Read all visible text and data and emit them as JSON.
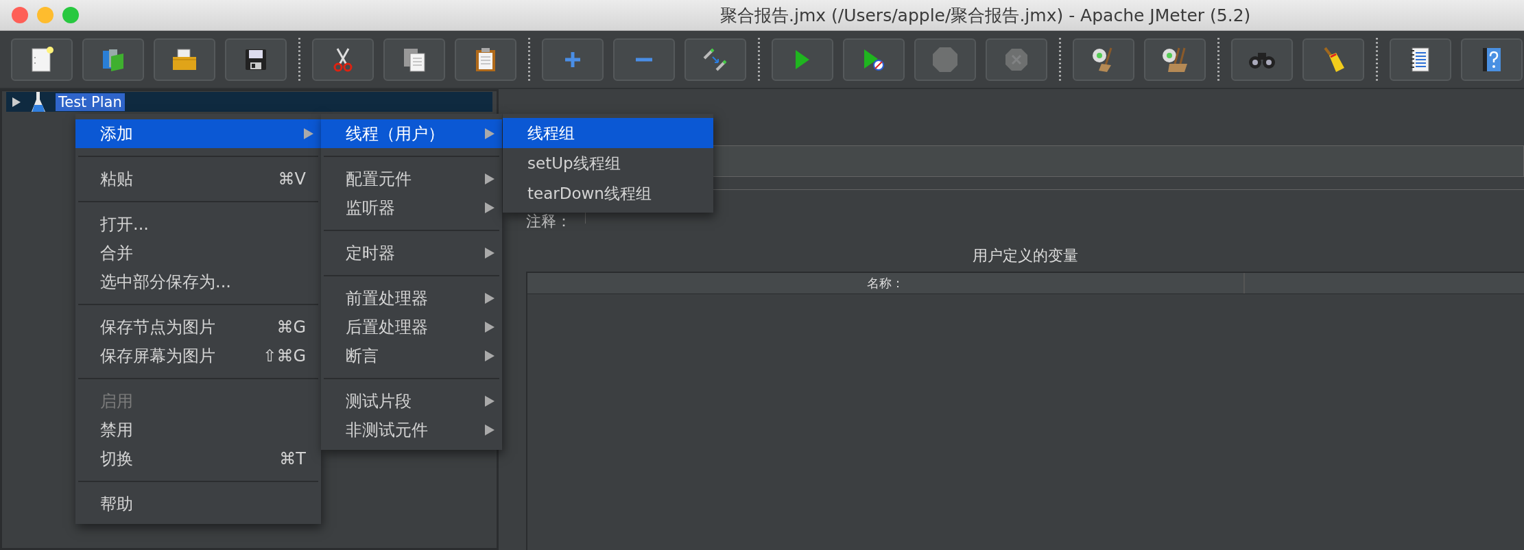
{
  "window": {
    "title": "聚合报告.jmx (/Users/apple/聚合报告.jmx) - Apache JMeter (5.2)"
  },
  "toolbar": {
    "groups": [
      {
        "buttons": [
          {
            "kind": "new",
            "disabled": false
          },
          {
            "kind": "templates",
            "disabled": false
          },
          {
            "kind": "open",
            "disabled": false
          },
          {
            "kind": "save",
            "disabled": false
          }
        ]
      },
      {
        "buttons": [
          {
            "kind": "cut",
            "disabled": false
          },
          {
            "kind": "copy",
            "disabled": false
          },
          {
            "kind": "paste",
            "disabled": false
          }
        ]
      },
      {
        "buttons": [
          {
            "kind": "expand",
            "disabled": false
          },
          {
            "kind": "collapse",
            "disabled": false
          },
          {
            "kind": "toggle",
            "disabled": false
          }
        ]
      },
      {
        "buttons": [
          {
            "kind": "start",
            "disabled": false
          },
          {
            "kind": "start_no_timers",
            "disabled": false
          },
          {
            "kind": "stop",
            "disabled": true
          },
          {
            "kind": "shutdown",
            "disabled": true
          }
        ]
      },
      {
        "buttons": [
          {
            "kind": "clear",
            "disabled": false
          },
          {
            "kind": "clear_all",
            "disabled": false
          }
        ]
      },
      {
        "buttons": [
          {
            "kind": "search",
            "disabled": false
          },
          {
            "kind": "reset_search",
            "disabled": false
          }
        ]
      },
      {
        "buttons": [
          {
            "kind": "function_helper",
            "disabled": false
          },
          {
            "kind": "help",
            "disabled": false
          }
        ]
      }
    ]
  },
  "tree": [
    {
      "label": "Test Plan",
      "expanded": false,
      "selected": true
    }
  ],
  "context_menu": {
    "sections": [
      {
        "items": [
          {
            "label": "添加",
            "submenu": true,
            "disabled": false,
            "selected": true
          }
        ]
      },
      {
        "items": [
          {
            "label": "粘贴",
            "shortcut": "⌘V",
            "submenu": false,
            "disabled": false,
            "selected": false
          }
        ]
      },
      {
        "items": [
          {
            "label": "打开...",
            "submenu": false,
            "disabled": false,
            "selected": false
          },
          {
            "label": "合并",
            "submenu": false,
            "disabled": false,
            "selected": false
          },
          {
            "label": "选中部分保存为...",
            "submenu": false,
            "disabled": false,
            "selected": false
          }
        ]
      },
      {
        "items": [
          {
            "label": "保存节点为图片",
            "shortcut": "⌘G",
            "submenu": false,
            "disabled": false,
            "selected": false
          },
          {
            "label": "保存屏幕为图片",
            "shortcut": "⇧⌘G",
            "submenu": false,
            "disabled": false,
            "selected": false
          }
        ]
      },
      {
        "items": [
          {
            "label": "启用",
            "submenu": false,
            "disabled": true,
            "selected": false
          },
          {
            "label": "禁用",
            "submenu": false,
            "disabled": false,
            "selected": false
          },
          {
            "label": "切换",
            "shortcut": "⌘T",
            "submenu": false,
            "disabled": false,
            "selected": false
          }
        ]
      },
      {
        "items": [
          {
            "label": "帮助",
            "submenu": false,
            "disabled": false,
            "selected": false
          }
        ]
      }
    ]
  },
  "add_submenu": {
    "sections": [
      {
        "items": [
          {
            "label": "线程（用户）",
            "submenu": true,
            "disabled": false,
            "selected": true
          }
        ]
      },
      {
        "items": [
          {
            "label": "配置元件",
            "submenu": true,
            "disabled": false,
            "selected": false
          },
          {
            "label": "监听器",
            "submenu": true,
            "disabled": false,
            "selected": false
          }
        ]
      },
      {
        "items": [
          {
            "label": "定时器",
            "submenu": true,
            "disabled": false,
            "selected": false
          }
        ]
      },
      {
        "items": [
          {
            "label": "前置处理器",
            "submenu": true,
            "disabled": false,
            "selected": false
          },
          {
            "label": "后置处理器",
            "submenu": true,
            "disabled": false,
            "selected": false
          },
          {
            "label": "断言",
            "submenu": true,
            "disabled": false,
            "selected": false
          }
        ]
      },
      {
        "items": [
          {
            "label": "测试片段",
            "submenu": true,
            "disabled": false,
            "selected": false
          },
          {
            "label": "非测试元件",
            "submenu": true,
            "disabled": false,
            "selected": false
          }
        ]
      }
    ]
  },
  "threads_submenu": {
    "items": [
      {
        "label": "线程组",
        "selected": true
      },
      {
        "label": "setUp线程组",
        "selected": false
      },
      {
        "label": "tearDown线程组",
        "selected": false
      }
    ]
  },
  "form": {
    "comment_label": "注释："
  },
  "variables": {
    "title": "用户定义的变量",
    "columns": [
      "名称："
    ]
  }
}
